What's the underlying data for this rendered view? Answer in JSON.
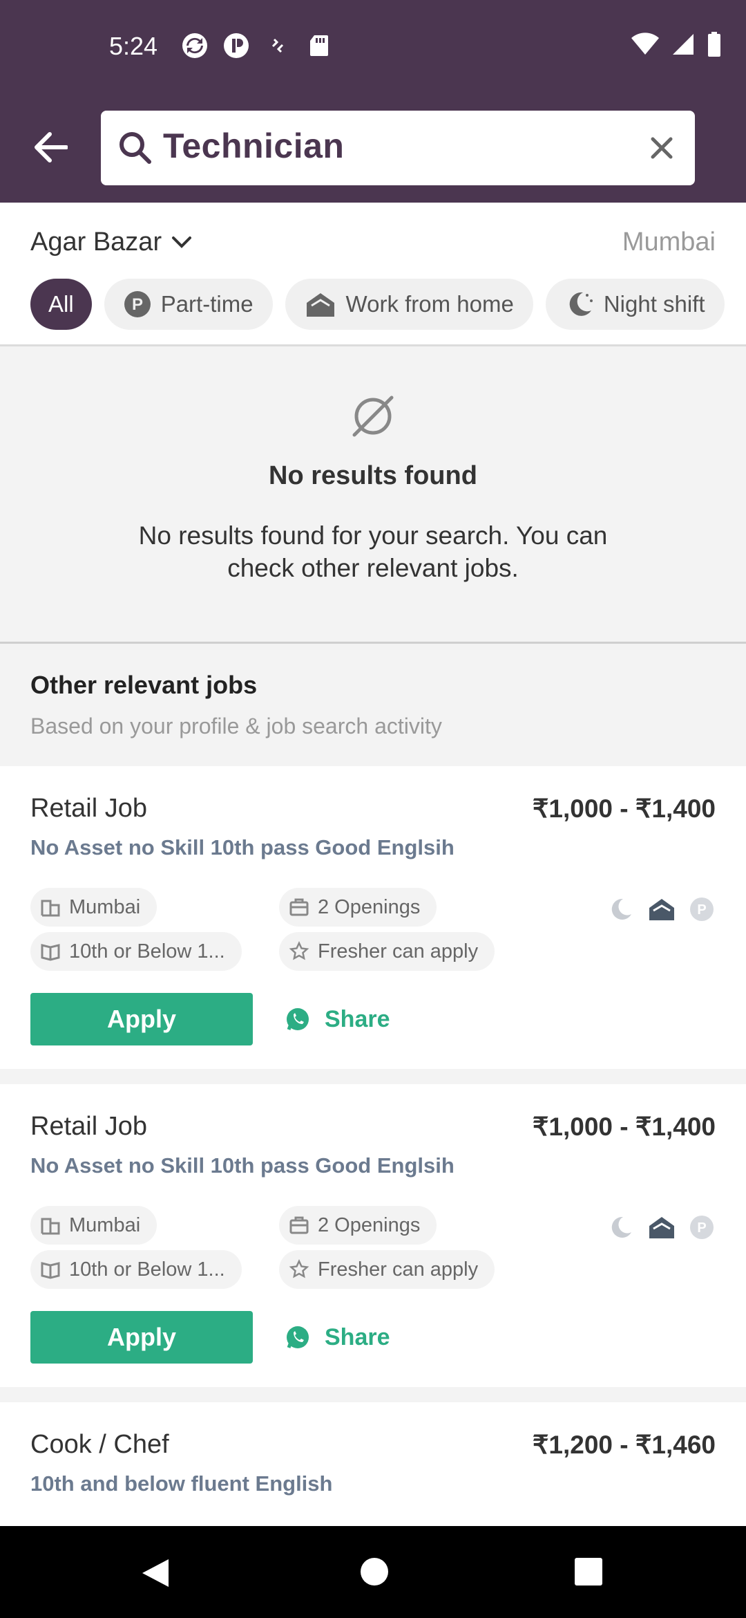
{
  "status_bar": {
    "time": "5:24"
  },
  "search": {
    "query": "Technician"
  },
  "location": {
    "area": "Agar Bazar",
    "city": "Mumbai"
  },
  "filters": [
    {
      "label": "All",
      "active": true
    },
    {
      "label": "Part-time",
      "icon": "part-time-icon"
    },
    {
      "label": "Work from home",
      "icon": "home-icon"
    },
    {
      "label": "Night shift",
      "icon": "night-shift-icon"
    }
  ],
  "empty_state": {
    "title": "No results found",
    "description": "No results found for your search. You can check other relevant jobs."
  },
  "other_jobs": {
    "title": "Other relevant jobs",
    "subtitle": "Based on your profile & job search activity"
  },
  "jobs": [
    {
      "title": "Retail Job",
      "salary": "₹1,000 - ₹1,400",
      "subtitle": "No Asset no Skill 10th pass Good Englsih",
      "location": "Mumbai",
      "openings": "2 Openings",
      "education": "10th or Below 1...",
      "experience": "Fresher can apply",
      "apply_label": "Apply",
      "share_label": "Share"
    },
    {
      "title": "Retail Job",
      "salary": "₹1,000 - ₹1,400",
      "subtitle": "No Asset no Skill 10th pass Good Englsih",
      "location": "Mumbai",
      "openings": "2 Openings",
      "education": "10th or Below 1...",
      "experience": "Fresher can apply",
      "apply_label": "Apply",
      "share_label": "Share"
    },
    {
      "title": "Cook / Chef",
      "salary": "₹1,200 - ₹1,460",
      "subtitle": "10th and below fluent English"
    }
  ],
  "colors": {
    "header": "#4b3650",
    "accent_green": "#2cad84",
    "muted_blue": "#6b7a8f"
  }
}
